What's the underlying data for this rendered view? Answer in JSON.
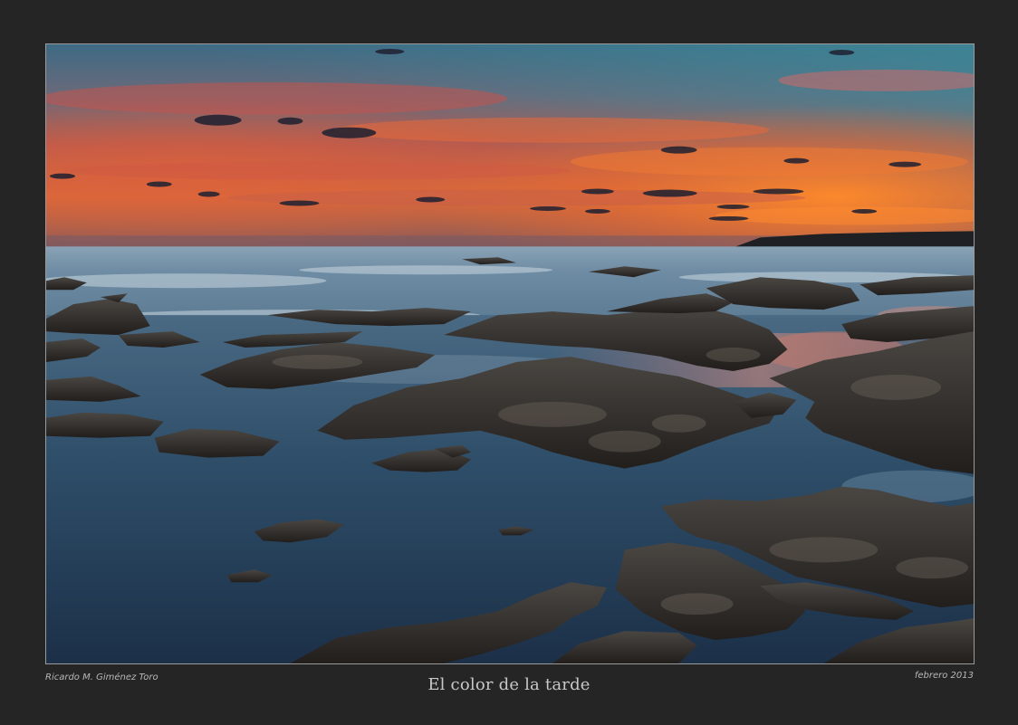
{
  "photo": {
    "subject": "seascape-sunset-rocky-shore",
    "colors": {
      "sky_top": "#3f6f86",
      "sky_orange": "#ef6a2a",
      "sky_pink": "#c65a5a",
      "horizon_glow": "#f08a3a",
      "sea": "#5e7f96",
      "water_shallow": "#2d4d68",
      "rock": "#2e2a28",
      "frame": "#252525",
      "border": "#9a9a9a"
    }
  },
  "captions": {
    "author": "Ricardo M. Giménez Toro",
    "title": "El color de la tarde",
    "date": "febrero 2013"
  }
}
